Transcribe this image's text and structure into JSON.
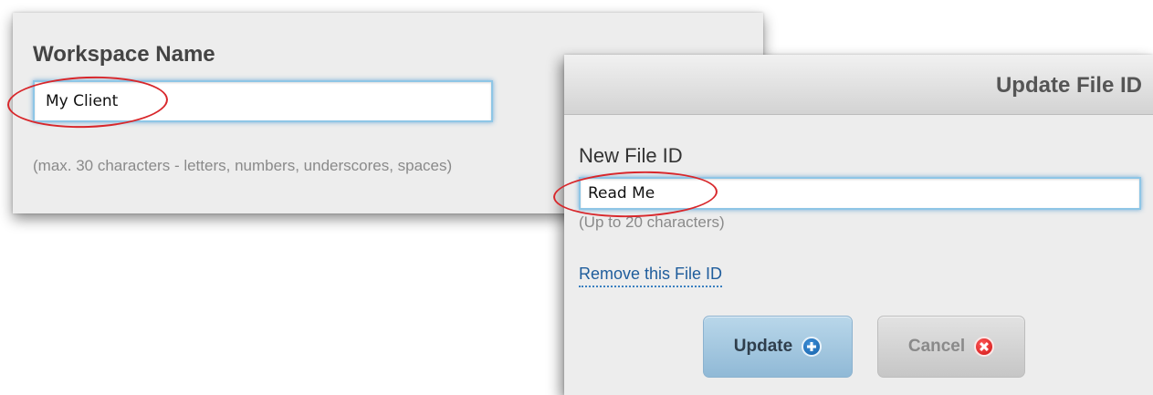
{
  "workspace": {
    "label": "Workspace Name",
    "input_value": "My Client",
    "hint": "(max. 30 characters - letters, numbers, underscores, spaces)"
  },
  "file_dialog": {
    "title": "Update File ID",
    "field_label": "New File ID",
    "input_value": "Read Me",
    "hint": "(Up to 20 characters)",
    "remove_link": "Remove this File ID",
    "update_button": "Update",
    "cancel_button": "Cancel"
  },
  "icons": {
    "update": "plus-circle-icon",
    "cancel": "x-circle-icon"
  },
  "colors": {
    "highlight": "#d8272b",
    "link": "#1f5d9c",
    "focus_glow": "#8ec6e6"
  }
}
